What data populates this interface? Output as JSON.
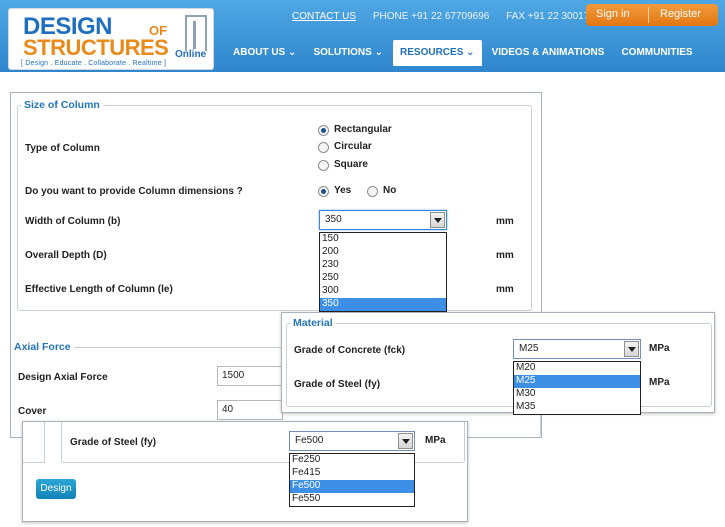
{
  "header": {
    "logo_line1": "DESIGN",
    "logo_line1_suffix": "OF",
    "logo_line2": "STRUCTURES",
    "logo_line2_suffix": "Online",
    "logo_tagline": "[ Design . Educate . Collaborate . Realtime ]",
    "contact_link": "CONTACT US",
    "phone": "PHONE  +91 22 67709696",
    "fax": "FAX  +91 22 30017000",
    "signin": "Sign in",
    "register": "Register",
    "nav": [
      {
        "label": "ABOUT US ⌄"
      },
      {
        "label": "SOLUTIONS ⌄"
      },
      {
        "label": "RESOURCES ⌄"
      },
      {
        "label": "VIDEOS & ANIMATIONS"
      },
      {
        "label": "COMMUNITIES"
      }
    ],
    "brand_blue": "#1f6fbf",
    "brand_orange": "#e98a1a"
  },
  "column_section": {
    "legend": "Size of Column",
    "type_label": "Type of Column",
    "type_options": [
      "Rectangular",
      "Circular",
      "Square"
    ],
    "type_selected": "Rectangular",
    "dims_label": "Do you want to provide Column dimensions ?",
    "dims_options": [
      "Yes",
      "No"
    ],
    "dims_selected": "Yes",
    "width_label": "Width of Column (b)",
    "width_value": "350",
    "width_options": [
      "150",
      "200",
      "230",
      "250",
      "300",
      "350"
    ],
    "depth_label": "Overall Depth (D)",
    "length_label": "Effective Length of Column (le)",
    "unit": "mm"
  },
  "axial_section": {
    "legend": "Axial Force",
    "force_label": "Design Axial Force",
    "force_value": "1500",
    "cover_label": "Cover",
    "cover_value": "40"
  },
  "material_popup": {
    "legend": "Material",
    "concrete_label": "Grade of Concrete (fck)",
    "concrete_value": "M25",
    "concrete_options": [
      "M20",
      "M25",
      "M30",
      "M35"
    ],
    "steel_label": "Grade of Steel (fy)",
    "unit": "MPa"
  },
  "steel_popup": {
    "steel_label": "Grade of Steel (fy)",
    "steel_value": "Fe500",
    "steel_options": [
      "Fe250",
      "Fe415",
      "Fe500",
      "Fe550"
    ],
    "unit": "MPa"
  },
  "design_button": "Design"
}
